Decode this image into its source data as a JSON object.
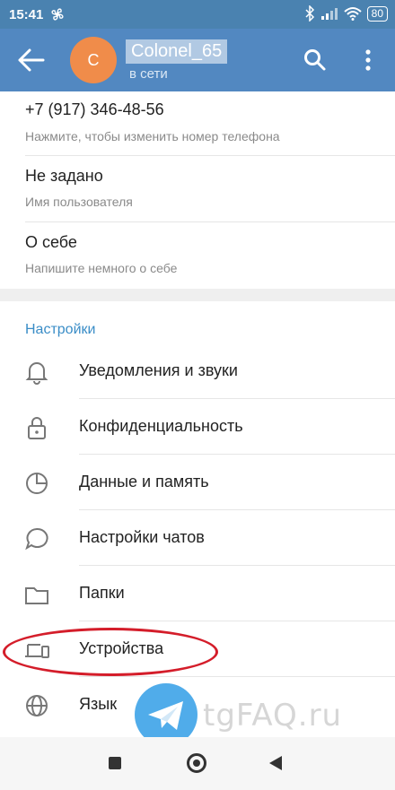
{
  "status_bar": {
    "time": "15:41",
    "battery": "80"
  },
  "header": {
    "avatar_letter": "C",
    "name": "Colonel_65",
    "status": "в сети"
  },
  "account": {
    "phone_value": "+7 (917) 346-48-56",
    "phone_hint": "Нажмите, чтобы изменить номер телефона",
    "username_value": "Не задано",
    "username_hint": "Имя пользователя",
    "bio_value": "О себе",
    "bio_hint": "Напишите немного о себе"
  },
  "settings": {
    "title": "Настройки",
    "items": [
      {
        "label": "Уведомления и звуки",
        "icon": "bell-icon"
      },
      {
        "label": "Конфиденциальность",
        "icon": "lock-icon"
      },
      {
        "label": "Данные и память",
        "icon": "pie-chart-icon"
      },
      {
        "label": "Настройки чатов",
        "icon": "chat-bubble-icon"
      },
      {
        "label": "Папки",
        "icon": "folder-icon"
      },
      {
        "label": "Устройства",
        "icon": "devices-icon"
      },
      {
        "label": "Язык",
        "icon": "globe-icon"
      }
    ]
  },
  "watermark": {
    "text": "tgFAQ.ru"
  },
  "colors": {
    "header": "#5288c1",
    "status_bar": "#4a82b0",
    "accent": "#3a8dc7",
    "avatar": "#f08c4a",
    "highlight_oval": "#d41d2a"
  }
}
